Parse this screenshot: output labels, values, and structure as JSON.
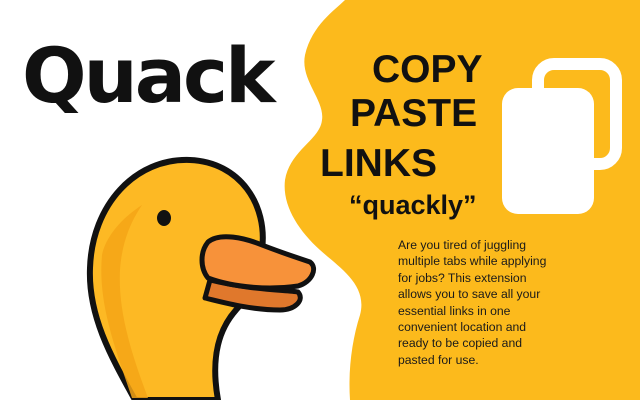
{
  "brand": {
    "name": "Quack"
  },
  "headline": {
    "line1": "COPY",
    "line2": "PASTE",
    "line3": "LINKS"
  },
  "tagline": "“quackly”",
  "description": "Are you tired of juggling multiple tabs while applying for jobs? This extension allows you to save all your essential links in one convenient location and ready to be copied and pasted for use.",
  "icons": {
    "duck": "duck-head-icon",
    "clipboard": "copy-clipboard-icon"
  },
  "colors": {
    "accent_yellow": "#fcba1c",
    "duck_yellow": "#fdb924",
    "beak_orange": "#f4923b",
    "outline": "#111111",
    "background": "#ffffff"
  }
}
